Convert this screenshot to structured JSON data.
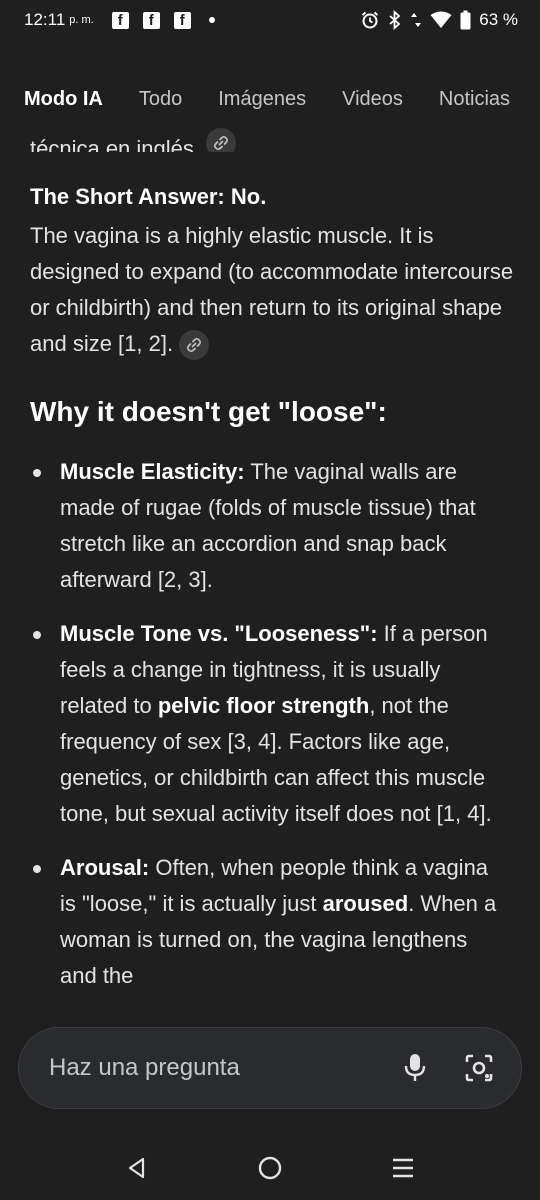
{
  "status": {
    "time": "12:11",
    "ampm": "p. m.",
    "battery": "63 %",
    "icons": [
      "facebook-icon",
      "facebook-icon",
      "facebook-icon",
      "notification-dot",
      "alarm-icon",
      "bluetooth-icon",
      "data-arrows-icon",
      "wifi-icon",
      "battery-icon"
    ]
  },
  "tabs": [
    {
      "label": "Modo IA",
      "active": true
    },
    {
      "label": "Todo",
      "active": false
    },
    {
      "label": "Imágenes",
      "active": false
    },
    {
      "label": "Videos",
      "active": false
    },
    {
      "label": "Noticias",
      "active": false
    }
  ],
  "content": {
    "cut_line": "técnica en inglés.",
    "short_answer_title": "The Short Answer: No.",
    "short_answer_text": "The vagina is a highly elastic muscle. It is designed to expand (to accommodate intercourse or childbirth) and then return to its original shape and size [1, 2].",
    "section_heading": "Why it doesn't get \"loose\":",
    "bullets": [
      {
        "title": "Muscle Elasticity:",
        "text": " The vaginal walls are made of rugae (folds of muscle tissue) that stretch like an accordion and snap back afterward [2, 3]."
      },
      {
        "title": "Muscle Tone vs. \"Looseness\":",
        "text_a": " If a person feels a change in tightness, it is usually related to ",
        "bold": "pelvic floor strength",
        "text_b": ", not the frequency of sex [3, 4]. Factors like age, genetics, or childbirth can affect this muscle tone, but sexual activity itself does not [1, 4]."
      },
      {
        "title": "Arousal:",
        "text_a": " Often, when people think a vagina is \"loose,\" it is actually just ",
        "bold": "aroused",
        "text_b": ". When a woman is turned on, the vagina lengthens and the"
      }
    ]
  },
  "ask_bar": {
    "placeholder": "Haz una pregunta",
    "icons": [
      "microphone-icon",
      "lens-camera-icon"
    ]
  },
  "navbar": {
    "icons": [
      "back-icon",
      "home-icon",
      "menu-icon"
    ]
  },
  "colors": {
    "background": "#1f1f1f",
    "text": "#e3e3e3",
    "heading": "#ffffff",
    "ask_bar": "#2a2b2e"
  }
}
